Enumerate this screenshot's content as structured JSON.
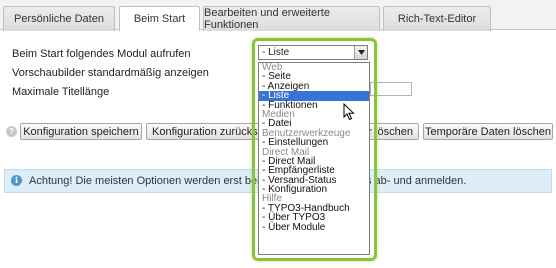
{
  "tabs": [
    {
      "label": "Persönliche Daten"
    },
    {
      "label": "Beim Start"
    },
    {
      "label": "Bearbeiten und erweiterte Funktionen"
    },
    {
      "label": "Rich-Text-Editor"
    }
  ],
  "form": {
    "start_module_label": "Beim Start folgendes Modul aufrufen",
    "start_module_value": "- Liste",
    "thumbnails_label": "Vorschaubilder standardmäßig anzeigen",
    "title_length_label": "Maximale Titellänge"
  },
  "buttons": {
    "save": "Konfiguration speichern",
    "reset": "Konfiguration zurückset",
    "user_delete_fragment": "r löschen",
    "temp_delete": "Temporäre Daten löschen"
  },
  "info": {
    "text_left": "Achtung! Die meisten Optionen werden erst beim",
    "text_right": "s ab- und anmelden."
  },
  "dropdown": {
    "options": [
      {
        "type": "group",
        "label": "Web"
      },
      {
        "type": "item",
        "label": "- Seite"
      },
      {
        "type": "item",
        "label": "- Anzeigen"
      },
      {
        "type": "item",
        "label": "- Liste",
        "selected": true
      },
      {
        "type": "item",
        "label": "- Funktionen"
      },
      {
        "type": "group",
        "label": "Medien"
      },
      {
        "type": "item",
        "label": "- Datei"
      },
      {
        "type": "group",
        "label": "Benutzerwerkzeuge"
      },
      {
        "type": "item",
        "label": "- Einstellungen"
      },
      {
        "type": "group",
        "label": "Direct Mail"
      },
      {
        "type": "item",
        "label": "- Direct Mail"
      },
      {
        "type": "item",
        "label": "- Empfängerliste"
      },
      {
        "type": "item",
        "label": "- Versand-Status"
      },
      {
        "type": "item",
        "label": "- Konfiguration"
      },
      {
        "type": "group",
        "label": "Hilfe"
      },
      {
        "type": "item",
        "label": "- TYPO3-Handbuch"
      },
      {
        "type": "item",
        "label": "- Über TYPO3"
      },
      {
        "type": "item",
        "label": "- Über Module"
      }
    ]
  },
  "colors": {
    "highlight_border": "#8ac43f",
    "selection": "#3874d8",
    "info_bg": "#ddeef8",
    "info_icon": "#4b98cf"
  },
  "icons": {
    "help": "help-icon",
    "info": "info-icon",
    "dropdown_arrow": "chevron-down-icon",
    "cursor": "mouse-pointer-icon"
  }
}
